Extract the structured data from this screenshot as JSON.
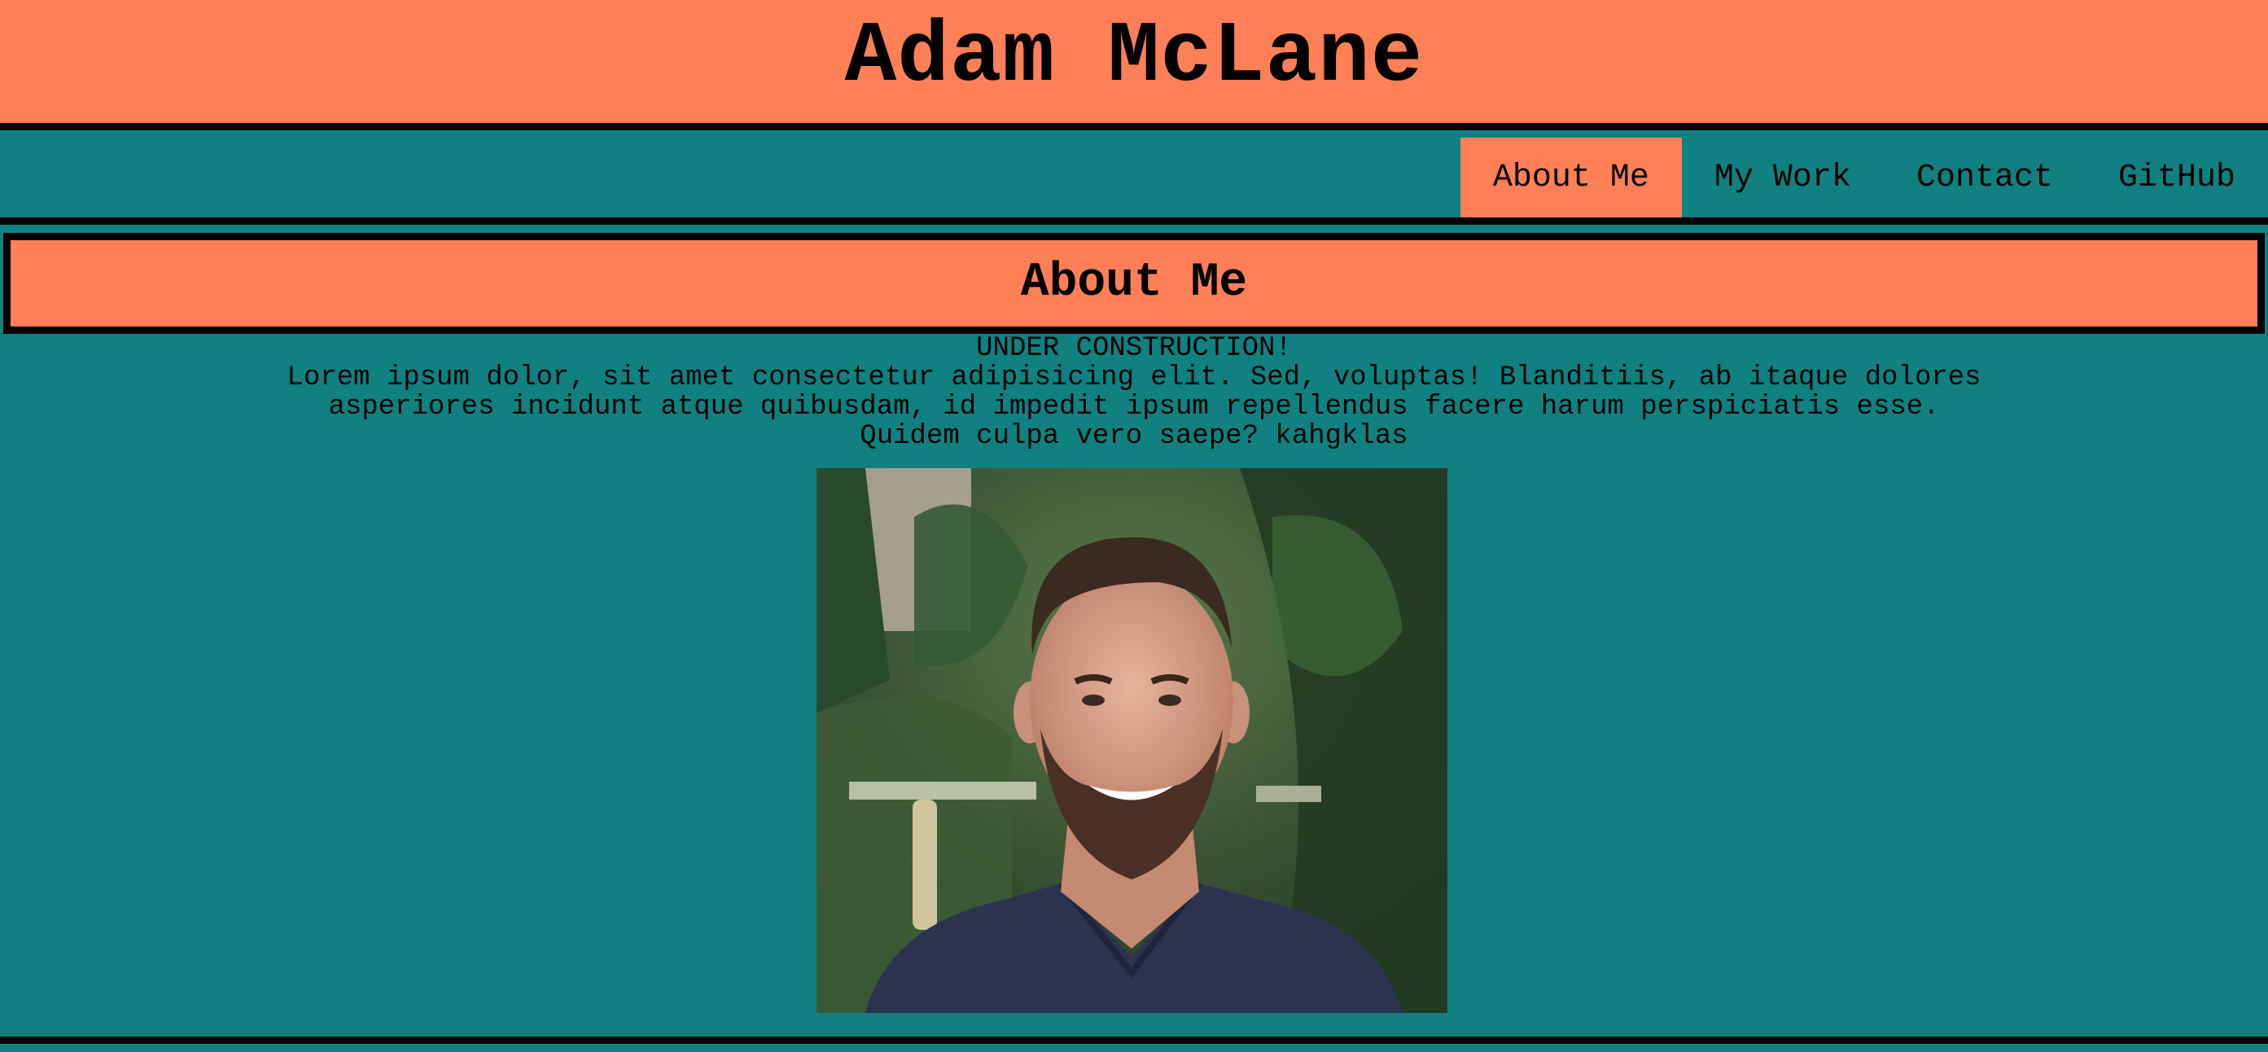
{
  "header": {
    "title": "Adam McLane"
  },
  "nav": {
    "items": [
      {
        "label": "About Me",
        "active": true
      },
      {
        "label": "My Work",
        "active": false
      },
      {
        "label": "Contact",
        "active": false
      },
      {
        "label": "GitHub",
        "active": false
      }
    ]
  },
  "about": {
    "heading": "About Me",
    "lines": [
      "UNDER CONSTRUCTION!",
      "Lorem ipsum dolor, sit amet consectetur adipisicing elit. Sed, voluptas! Blanditiis, ab itaque dolores",
      "asperiores incidunt atque quibusdam, id impedit ipsum repellendus facere harum perspiciatis esse.",
      "Quidem culpa vero saepe? kahgklas"
    ]
  },
  "colors": {
    "header_bg": "#ff7f57",
    "page_bg": "#108080",
    "border": "#000000"
  }
}
